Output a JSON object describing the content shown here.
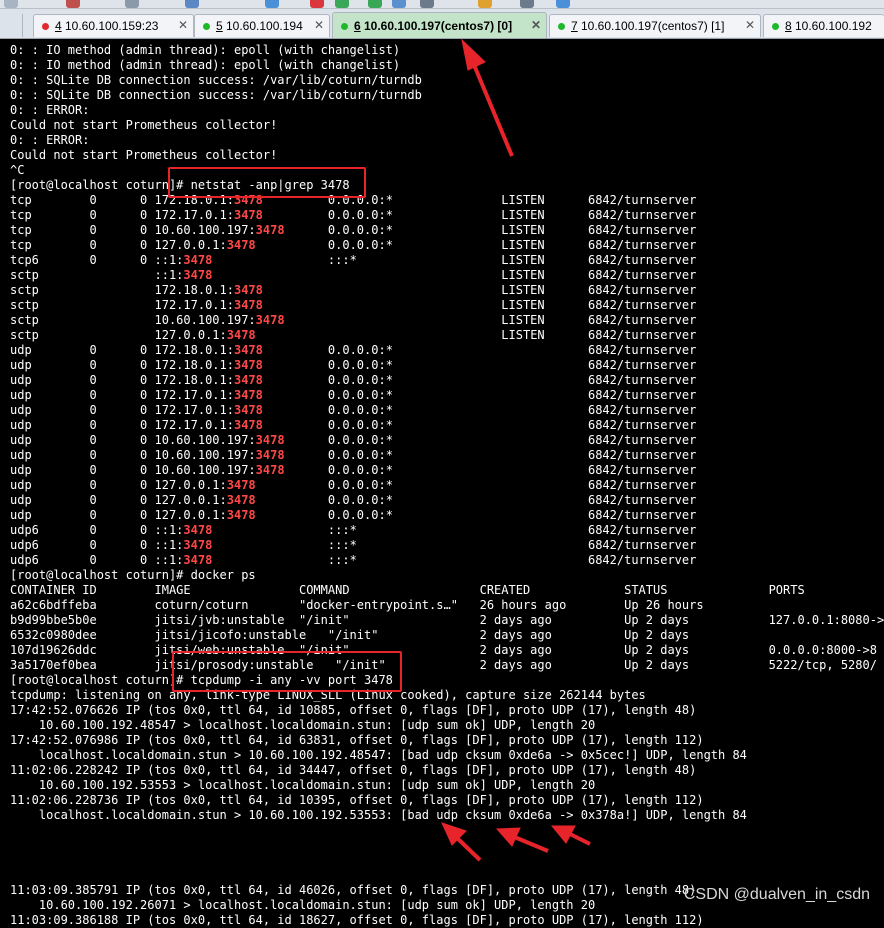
{
  "tabs": [
    {
      "num": "4",
      "label": " 10.60.100.159:23",
      "dot": "#e0282d",
      "closable": true,
      "active": false
    },
    {
      "num": "5",
      "label": " 10.60.100.194",
      "dot": "#1fb82a",
      "closable": true,
      "active": false
    },
    {
      "num": "6",
      "label": " 10.60.100.197(centos7) [0]",
      "dot": "#1fb82a",
      "closable": true,
      "active": true
    },
    {
      "num": "7",
      "label": " 10.60.100.197(centos7) [1]",
      "dot": "#1fb82a",
      "closable": true,
      "active": false
    },
    {
      "num": "8",
      "label": " 10.60.100.192",
      "dot": "#1fb82a",
      "closable": false,
      "active": false
    }
  ],
  "terminal": {
    "lines": [
      "0: : IO method (admin thread): epoll (with changelist)",
      "0: : IO method (admin thread): epoll (with changelist)",
      "0: : SQLite DB connection success: /var/lib/coturn/turndb",
      "0: : SQLite DB connection success: /var/lib/coturn/turndb",
      "0: : ERROR:",
      "Could not start Prometheus collector!",
      "0: : ERROR:",
      "Could not start Prometheus collector!",
      "^C",
      "[root@localhost coturn]# netstat -anp|grep 3478",
      "tcp        0      0 172.18.0.1:3478         0.0.0.0:*               LISTEN      6842/turnserver",
      "tcp        0      0 172.17.0.1:3478         0.0.0.0:*               LISTEN      6842/turnserver",
      "tcp        0      0 10.60.100.197:3478      0.0.0.0:*               LISTEN      6842/turnserver",
      "tcp        0      0 127.0.0.1:3478          0.0.0.0:*               LISTEN      6842/turnserver",
      "tcp6       0      0 ::1:3478                :::*                    LISTEN      6842/turnserver",
      "sctp                ::1:3478                                        LISTEN      6842/turnserver",
      "sctp                172.18.0.1:3478                                 LISTEN      6842/turnserver",
      "sctp                172.17.0.1:3478                                 LISTEN      6842/turnserver",
      "sctp                10.60.100.197:3478                              LISTEN      6842/turnserver",
      "sctp                127.0.0.1:3478                                  LISTEN      6842/turnserver",
      "udp        0      0 172.18.0.1:3478         0.0.0.0:*                           6842/turnserver",
      "udp        0      0 172.18.0.1:3478         0.0.0.0:*                           6842/turnserver",
      "udp        0      0 172.18.0.1:3478         0.0.0.0:*                           6842/turnserver",
      "udp        0      0 172.17.0.1:3478         0.0.0.0:*                           6842/turnserver",
      "udp        0      0 172.17.0.1:3478         0.0.0.0:*                           6842/turnserver",
      "udp        0      0 172.17.0.1:3478         0.0.0.0:*                           6842/turnserver",
      "udp        0      0 10.60.100.197:3478      0.0.0.0:*                           6842/turnserver",
      "udp        0      0 10.60.100.197:3478      0.0.0.0:*                           6842/turnserver",
      "udp        0      0 10.60.100.197:3478      0.0.0.0:*                           6842/turnserver",
      "udp        0      0 127.0.0.1:3478          0.0.0.0:*                           6842/turnserver",
      "udp        0      0 127.0.0.1:3478          0.0.0.0:*                           6842/turnserver",
      "udp        0      0 127.0.0.1:3478          0.0.0.0:*                           6842/turnserver",
      "udp6       0      0 ::1:3478                :::*                                6842/turnserver",
      "udp6       0      0 ::1:3478                :::*                                6842/turnserver",
      "udp6       0      0 ::1:3478                :::*                                6842/turnserver",
      "[root@localhost coturn]# docker ps",
      "CONTAINER ID        IMAGE               COMMAND                  CREATED             STATUS              PORTS",
      "a62c6bdffeba        coturn/coturn       \"docker-entrypoint.s…\"   26 hours ago        Up 26 hours",
      "b9d99bbe5b0e        jitsi/jvb:unstable  \"/init\"                  2 days ago          Up 2 days           127.0.0.1:8080->",
      "6532c0980dee        jitsi/jicofo:unstable   \"/init\"              2 days ago          Up 2 days",
      "107d19626ddc        jitsi/web:unstable  \"/init\"                  2 days ago          Up 2 days           0.0.0.0:8000->8",
      "3a5170ef0bea        jitsi/prosody:unstable   \"/init\"             2 days ago          Up 2 days           5222/tcp, 5280/",
      "[root@localhost coturn]# tcpdump -i any -vv port 3478",
      "tcpdump: listening on any, link-type LINUX_SLL (Linux cooked), capture size 262144 bytes",
      "17:42:52.076626 IP (tos 0x0, ttl 64, id 10885, offset 0, flags [DF], proto UDP (17), length 48)",
      "    10.60.100.192.48547 > localhost.localdomain.stun: [udp sum ok] UDP, length 20",
      "17:42:52.076986 IP (tos 0x0, ttl 64, id 63831, offset 0, flags [DF], proto UDP (17), length 112)",
      "    localhost.localdomain.stun > 10.60.100.192.48547: [bad udp cksum 0xde6a -> 0x5cec!] UDP, length 84",
      "11:02:06.228242 IP (tos 0x0, ttl 64, id 34447, offset 0, flags [DF], proto UDP (17), length 48)",
      "    10.60.100.192.53553 > localhost.localdomain.stun: [udp sum ok] UDP, length 20",
      "11:02:06.228736 IP (tos 0x0, ttl 64, id 10395, offset 0, flags [DF], proto UDP (17), length 112)",
      "    localhost.localdomain.stun > 10.60.100.192.53553: [bad udp cksum 0xde6a -> 0x378a!] UDP, length 84",
      "",
      "",
      "",
      "",
      "11:03:09.385791 IP (tos 0x0, ttl 64, id 46026, offset 0, flags [DF], proto UDP (17), length 48)",
      "    10.60.100.192.26071 > localhost.localdomain.stun: [udp sum ok] UDP, length 20",
      "11:03:09.386188 IP (tos 0x0, ttl 64, id 18627, offset 0, flags [DF], proto UDP (17), length 112)"
    ],
    "highlight_term": "3478",
    "highlight_color": "#ff4747"
  },
  "watermark": "CSDN @dualven_in_csdn",
  "colors": {
    "annotation": "#e8242b",
    "active_tab": "#c3e4c9",
    "terminal_bg": "#000000",
    "terminal_fg": "#ffffff"
  }
}
